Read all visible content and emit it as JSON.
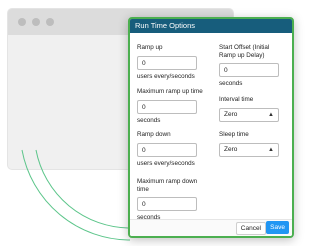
{
  "dialog": {
    "title": "Run Time Options",
    "left_column": [
      {
        "label": "Ramp up",
        "value": "0",
        "unit": "users every/seconds"
      },
      {
        "label": "Maximum ramp up time",
        "value": "0",
        "unit": "seconds"
      },
      {
        "label": "Ramp down",
        "value": "0",
        "unit": "users every/seconds"
      },
      {
        "label": "Maximum ramp down time",
        "value": "0",
        "unit": "seconds"
      }
    ],
    "right_column": {
      "start_offset": {
        "label": "Start Offset (Initial Ramp up Delay)",
        "value": "0",
        "unit": "seconds"
      },
      "interval_time": {
        "label": "Interval time",
        "selected": "Zero"
      },
      "sleep_time": {
        "label": "Sleep time",
        "selected": "Zero"
      }
    },
    "buttons": {
      "cancel": "Cancel",
      "save": "Save"
    }
  },
  "colors": {
    "accent_border": "#4caf50",
    "header_bg": "#175d7c",
    "save_button": "#2196f3",
    "decor_lines": "#5cc58a"
  }
}
